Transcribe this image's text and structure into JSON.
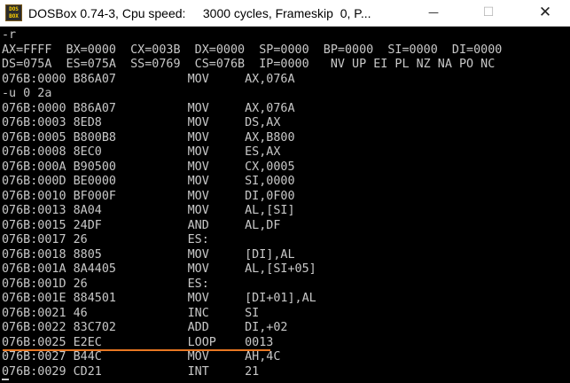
{
  "window": {
    "title": "DOSBox 0.74-3, Cpu speed:     3000 cycles, Frameskip  0, P...",
    "icon_label_top": "DOS",
    "icon_label_bottom": "BOX",
    "minimize_glyph": "—",
    "maximize_glyph": "☐",
    "close_glyph": "✕",
    "annotation_color": "#e87722"
  },
  "console": {
    "lines": [
      "-r",
      "AX=FFFF  BX=0000  CX=003B  DX=0000  SP=0000  BP=0000  SI=0000  DI=0000",
      "DS=075A  ES=075A  SS=0769  CS=076B  IP=0000   NV UP EI PL NZ NA PO NC",
      "076B:0000 B86A07          MOV     AX,076A",
      "-u 0 2a",
      "076B:0000 B86A07          MOV     AX,076A",
      "076B:0003 8ED8            MOV     DS,AX",
      "076B:0005 B800B8          MOV     AX,B800",
      "076B:0008 8EC0            MOV     ES,AX",
      "076B:000A B90500          MOV     CX,0005",
      "076B:000D BE0000          MOV     SI,0000",
      "076B:0010 BF000F          MOV     DI,0F00",
      "076B:0013 8A04            MOV     AL,[SI]",
      "076B:0015 24DF            AND     AL,DF",
      "076B:0017 26              ES:",
      "076B:0018 8805            MOV     [DI],AL",
      "076B:001A 8A4405          MOV     AL,[SI+05]",
      "076B:001D 26              ES:",
      "076B:001E 884501          MOV     [DI+01],AL",
      "076B:0021 46              INC     SI",
      "076B:0022 83C702          ADD     DI,+02",
      "076B:0025 E2EC            LOOP    0013",
      "076B:0027 B44C            MOV     AH,4C",
      "076B:0029 CD21            INT     21",
      "-"
    ]
  }
}
